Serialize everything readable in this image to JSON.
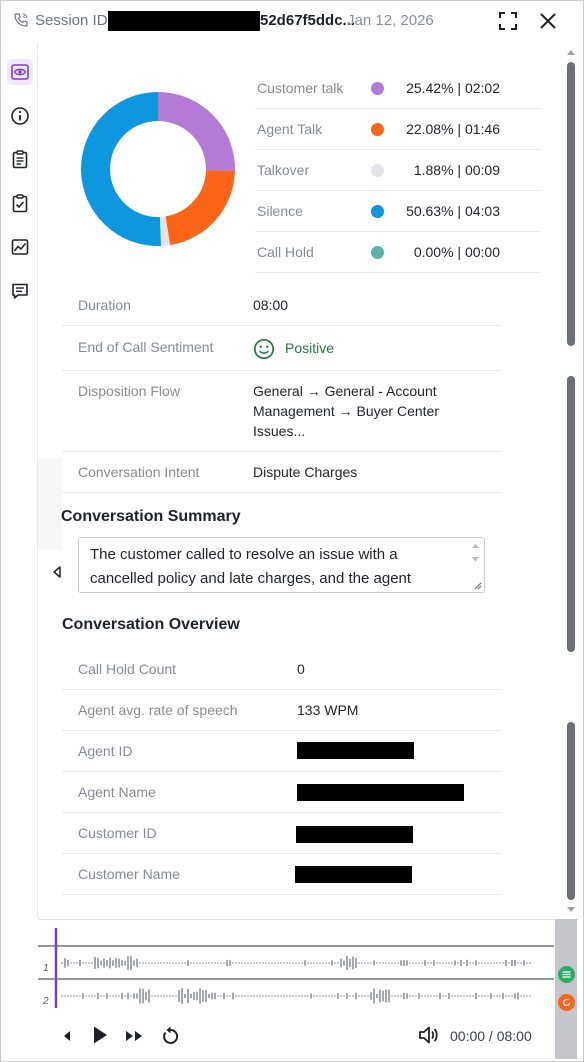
{
  "header": {
    "session_label": "Session ID:",
    "session_id_suffix": "52d67f5ddc...",
    "date": "Jan 12, 2026"
  },
  "rail": {
    "items": [
      {
        "icon": "eye-icon",
        "active": true
      },
      {
        "icon": "info-icon",
        "active": false
      },
      {
        "icon": "clipboard-icon",
        "active": false
      },
      {
        "icon": "clipboard-check-icon",
        "active": false
      },
      {
        "icon": "line-chart-icon",
        "active": false
      },
      {
        "icon": "message-icon",
        "active": false
      }
    ]
  },
  "talk_breakdown": {
    "items": [
      {
        "label": "Customer talk",
        "value": "25.42% | 02:02",
        "color": "#b57ad6"
      },
      {
        "label": "Agent Talk",
        "value": "22.08% | 01:46",
        "color": "#fc6417"
      },
      {
        "label": "Talkover",
        "value": "1.88% | 00:09",
        "color": "#e2e4ea"
      },
      {
        "label": "Silence",
        "value": "50.63% | 04:03",
        "color": "#0d97de"
      },
      {
        "label": "Call Hold",
        "value": "0.00% | 00:00",
        "color": "#5cb3a8"
      }
    ]
  },
  "chart_data": {
    "type": "pie",
    "title": "",
    "categories": [
      "Customer talk",
      "Agent Talk",
      "Talkover",
      "Silence",
      "Call Hold"
    ],
    "values": [
      25.42,
      22.08,
      1.88,
      50.63,
      0.0
    ],
    "colors": [
      "#b57ad6",
      "#fc6417",
      "#e2e4ea",
      "#0d97de",
      "#5cb3a8"
    ]
  },
  "details": {
    "duration_label": "Duration",
    "duration_value": "08:00",
    "sentiment_label": "End of Call Sentiment",
    "sentiment_value": "Positive",
    "disposition_label": "Disposition Flow",
    "disposition_line1": "General → General - Account",
    "disposition_line2": "Management → Buyer Center",
    "disposition_line3": "Issues...",
    "intent_label": "Conversation Intent",
    "intent_value": "Dispute Charges"
  },
  "summary": {
    "title": "Conversation Summary",
    "text": "The customer called to resolve an issue with a cancelled policy and late charges, and the agent"
  },
  "overview": {
    "title": "Conversation Overview",
    "rows": [
      {
        "label": "Call Hold Count",
        "value": "0"
      },
      {
        "label": "Agent avg. rate of speech",
        "value": "133 WPM"
      },
      {
        "label": "Agent ID",
        "value": ""
      },
      {
        "label": "Agent Name",
        "value": ""
      },
      {
        "label": "Customer ID",
        "value": ""
      },
      {
        "label": "Customer Name",
        "value": ""
      }
    ]
  },
  "player": {
    "track1_label": "1",
    "track2_label": "2",
    "time": "00:00 / 08:00",
    "track1_color": "#27ae60",
    "track2_color": "#fc6417"
  }
}
